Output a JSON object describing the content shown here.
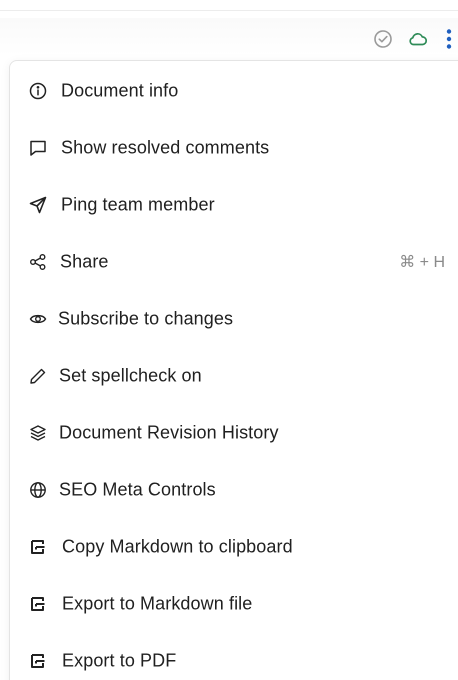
{
  "toolbar": {
    "icons": [
      "check-circle-icon",
      "cloud-icon",
      "more-vertical-icon"
    ],
    "colors": {
      "check": "#9a9a9a",
      "cloud": "#2e8b57",
      "more": "#1f5fbf"
    }
  },
  "menu": {
    "items": [
      {
        "label": "Document info",
        "icon": "info-icon"
      },
      {
        "label": "Show resolved comments",
        "icon": "comment-icon"
      },
      {
        "label": "Ping team member",
        "icon": "send-icon"
      },
      {
        "label": "Share",
        "icon": "share-icon",
        "shortcut": "⌘ + H"
      },
      {
        "label": "Subscribe to changes",
        "icon": "eye-icon"
      },
      {
        "label": "Set spellcheck on",
        "icon": "pencil-icon"
      },
      {
        "label": "Document Revision History",
        "icon": "layers-icon"
      },
      {
        "label": "SEO Meta Controls",
        "icon": "globe-icon"
      },
      {
        "label": "Copy Markdown to clipboard",
        "icon": "export-icon"
      },
      {
        "label": "Export to Markdown file",
        "icon": "export-icon"
      },
      {
        "label": "Export to PDF",
        "icon": "export-icon"
      }
    ]
  }
}
